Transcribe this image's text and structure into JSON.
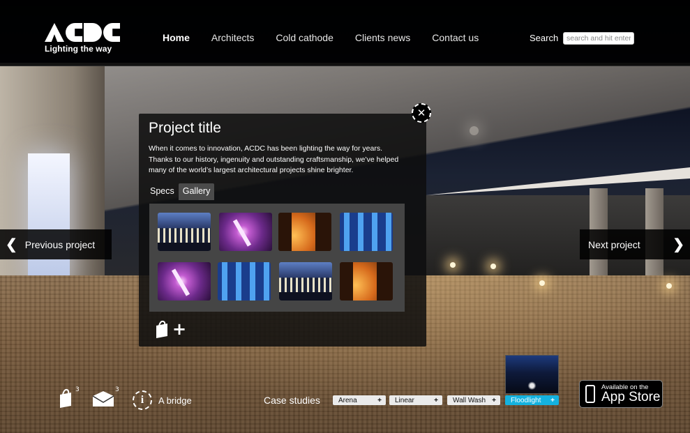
{
  "brand": {
    "tagline": "Lighting the way",
    "logo_text": "ACDC"
  },
  "nav": {
    "items": [
      "Home",
      "Architects",
      "Cold cathode",
      "Clients news",
      "Contact us"
    ],
    "active": "Home"
  },
  "search": {
    "label": "Search",
    "placeholder": "search and hit enter"
  },
  "side_nav": {
    "prev_label": "Previous project",
    "next_label": "Next project",
    "prev_icon": "chevron-left-icon",
    "next_icon": "chevron-right-icon"
  },
  "panel": {
    "title": "Project title",
    "description": "When it comes to innovation, ACDC has been lighting the way for years. Thanks to our history, ingenuity and outstanding craftsmanship, we’ve helped many of the world’s largest architectural projects shine brighter.",
    "tabs": [
      "Specs",
      "Gallery"
    ],
    "active_tab": "Gallery",
    "gallery": [
      "building-blue",
      "windmill-purple",
      "amber-facade",
      "blue-panels",
      "windmill-purple",
      "blue-panels",
      "building-blue",
      "amber-facade"
    ],
    "add_icon": "add-to-tray-icon",
    "close_icon": "close-icon"
  },
  "footer": {
    "tray_count": "3",
    "mail_count": "3",
    "info_label": "A bridge",
    "case_studies_label": "Case studies",
    "chips": [
      {
        "label": "Arena",
        "plus": "+"
      },
      {
        "label": "Linear",
        "plus": "+"
      },
      {
        "label": "Wall Wash",
        "plus": "+"
      },
      {
        "label": "Floodlight",
        "plus": "+"
      }
    ],
    "active_chip": "Floodlight",
    "appstore_small": "Available on the",
    "appstore_big": "App Store"
  },
  "colors": {
    "accent": "#14b2df",
    "header_bg": "#000000"
  }
}
